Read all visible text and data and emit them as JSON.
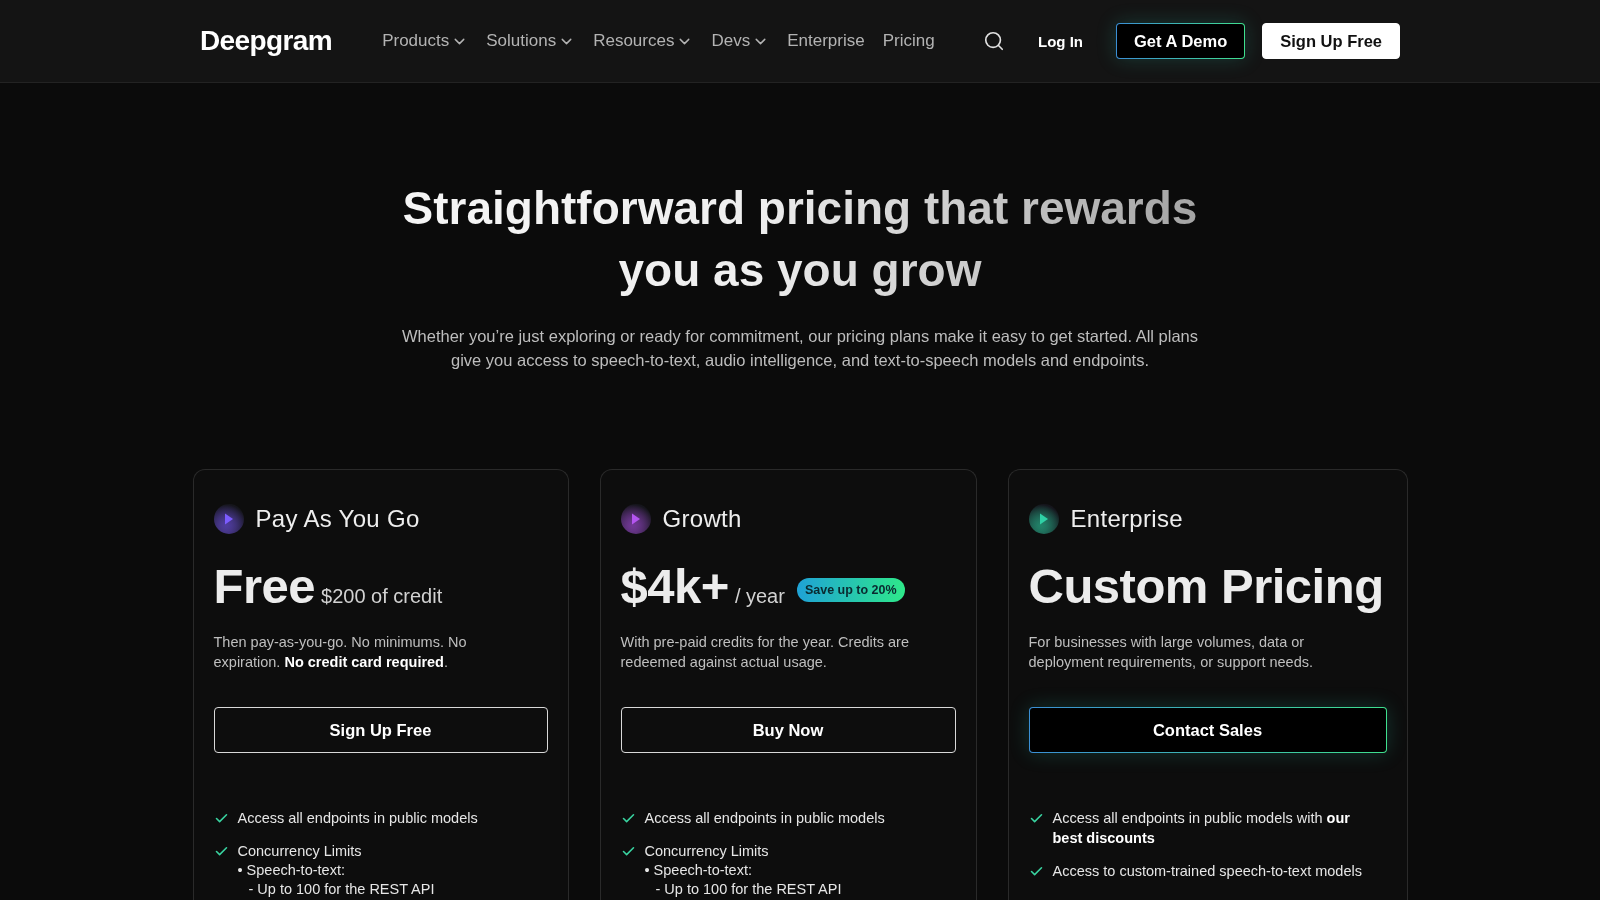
{
  "nav": {
    "logo": "Deepgram",
    "links": [
      {
        "label": "Products",
        "has_menu": true
      },
      {
        "label": "Solutions",
        "has_menu": true
      },
      {
        "label": "Resources",
        "has_menu": true
      },
      {
        "label": "Devs",
        "has_menu": true
      },
      {
        "label": "Enterprise",
        "has_menu": false
      },
      {
        "label": "Pricing",
        "has_menu": false
      }
    ],
    "login": "Log In",
    "buttons": [
      {
        "label": "Get A Demo",
        "kind": "glow"
      },
      {
        "label": "Sign Up Free",
        "kind": "solid"
      }
    ]
  },
  "hero": {
    "title": "Straightforward pricing that rewards you as you grow",
    "subtitle": "Whether you’re just exploring or ready for commitment, our pricing plans make it easy to get started. All plans give you access to speech-to-text, audio intelligence, and text-to-speech models and endpoints."
  },
  "plans": [
    {
      "name": "Pay As You Go",
      "color": "#7c5cff",
      "price": "Free",
      "price_note": "$200 of credit",
      "description": "Then pay-as-you-go. No minimums. No expiration. **No credit card required**.",
      "button": {
        "label": "Sign Up Free",
        "kind": "outline"
      },
      "features": [
        {
          "text": "Access all endpoints in public models"
        },
        {
          "text": "Concurrency Limits",
          "children": [
            {
              "text": "• Speech-to-text:",
              "children": [
                {
                  "text": "- Up to 100 for the REST API"
                }
              ]
            }
          ]
        }
      ]
    },
    {
      "name": "Growth",
      "color": "#b455f0",
      "price": "$4k+",
      "price_note": "/ year",
      "badge": "Save up to 20%",
      "description": "With pre-paid credits for the year. Credits are redeemed against actual usage.",
      "button": {
        "label": "Buy Now",
        "kind": "outline"
      },
      "features": [
        {
          "text": "Access all endpoints in public models"
        },
        {
          "text": "Concurrency Limits",
          "children": [
            {
              "text": "• Speech-to-text:",
              "children": [
                {
                  "text": "- Up to 100 for the REST API"
                }
              ]
            }
          ]
        }
      ]
    },
    {
      "name": "Enterprise",
      "color": "#2fd1a6",
      "price": "Custom Pricing",
      "description": "For businesses with large volumes, data or deployment requirements, or support needs.",
      "button": {
        "label": "Contact Sales",
        "kind": "glow"
      },
      "features": [
        {
          "text": "Access all endpoints in public models with **our best discounts**"
        },
        {
          "text": "Access to custom-trained speech-to-text models"
        }
      ]
    }
  ]
}
